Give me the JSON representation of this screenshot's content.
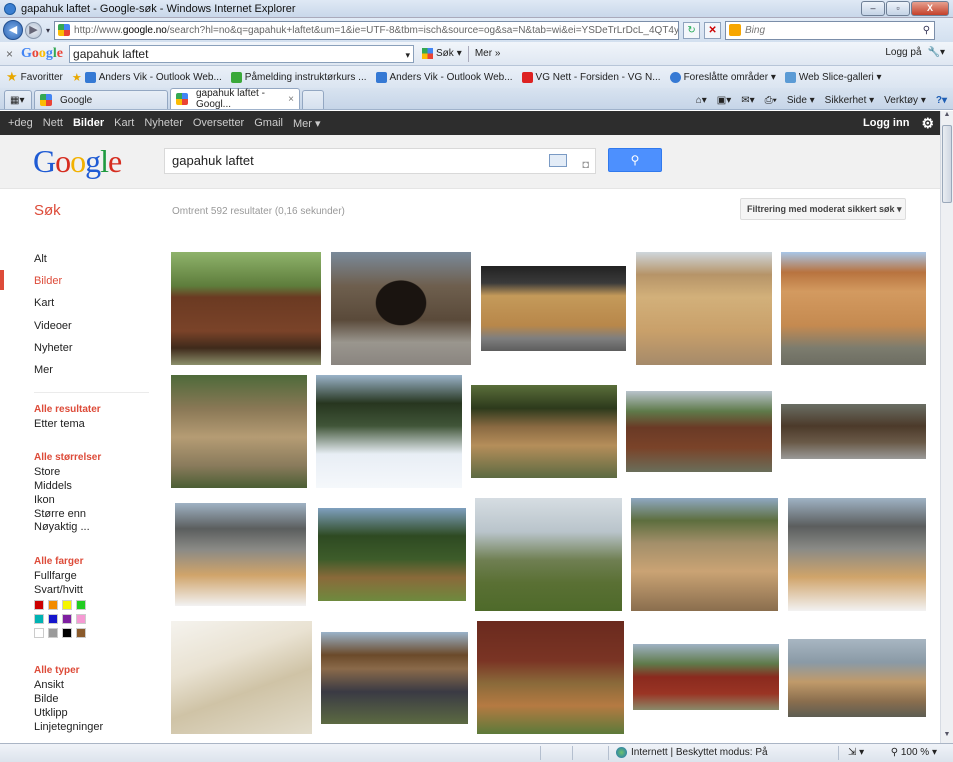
{
  "window": {
    "title": "gapahuk laftet - Google-søk - Windows Internet Explorer",
    "min": "–",
    "max": "▫",
    "close": "X"
  },
  "address": {
    "url_prefix": "http://www.",
    "url_host": "google.no",
    "url_rest": "/search?hl=no&q=gapahuk+laftet&um=1&ie=UTF-8&tbm=isch&source=og&sa=N&tab=wi&ei=YSDeTrLrDcL_4QT4y_TnBg&b",
    "search_placeholder": "Bing"
  },
  "google_toolbar": {
    "close": "×",
    "logo": "Google",
    "query": "gapahuk laftet",
    "sok": "Søk",
    "mer": "Mer »",
    "login": "Logg på"
  },
  "favorites": {
    "label": "Favoritter",
    "items": [
      "Anders Vik - Outlook Web...",
      "Påmelding instruktørkurs ...",
      "Anders Vik - Outlook Web...",
      "VG Nett - Forsiden - VG N...",
      "Foreslåtte områder ▾",
      "Web Slice-galleri ▾"
    ]
  },
  "tabs": {
    "items": [
      "Google",
      "gapahuk laftet - Googl..."
    ],
    "commands": [
      "Side ▾",
      "Sikkerhet ▾",
      "Verktøy ▾",
      "?▾"
    ]
  },
  "gbar": {
    "items": [
      "+deg",
      "Nett",
      "Bilder",
      "Kart",
      "Nyheter",
      "Oversetter",
      "Gmail",
      "Mer ▾"
    ],
    "login": "Logg inn",
    "settings_icon": "gear-icon"
  },
  "search": {
    "query": "gapahuk laftet",
    "button_icon": "search-icon"
  },
  "results": {
    "sok_label": "Søk",
    "stats": "Omtrent 592 resultater (0,16 sekunder)",
    "safe_search": "Filtrering med moderat sikkert søk ▾"
  },
  "sidebar": {
    "nav": [
      "Alt",
      "Bilder",
      "Kart",
      "Videoer",
      "Nyheter",
      "Mer"
    ],
    "results_head": "Alle resultater",
    "results_items": [
      "Etter tema"
    ],
    "size_head": "Alle størrelser",
    "size_items": [
      "Store",
      "Middels",
      "Ikon",
      "Større enn",
      "Nøyaktig ..."
    ],
    "color_head": "Alle farger",
    "color_items": [
      "Fullfarge",
      "Svart/hvitt"
    ],
    "colors": [
      "#cc0000",
      "#f28b00",
      "#f5f500",
      "#22cc22",
      "#00b3b3",
      "#1515cc",
      "#7e1fa1",
      "#f59ad3",
      "#ffffff",
      "#9a9a9a",
      "#000000",
      "#8a5a2b"
    ],
    "type_head": "Alle typer",
    "type_items": [
      "Ansikt",
      "Bilde",
      "Utklipp",
      "Linjetegninger"
    ]
  },
  "statusbar": {
    "zone": "Internett | Beskyttet modus: På",
    "zoom": "100 %"
  }
}
